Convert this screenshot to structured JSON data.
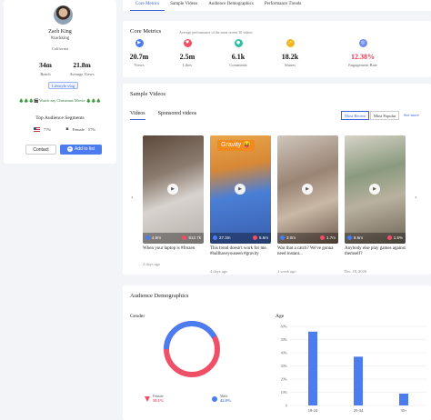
{
  "profile": {
    "name": "Zach King",
    "handle": "#zachking",
    "location": "California",
    "stats": [
      {
        "value": "34m",
        "label": "Reach"
      },
      {
        "value": "21.8m",
        "label": "Average Views"
      }
    ],
    "tag": "Lifestyle vlog",
    "bio": "🎄🎄🎄🎬Watch my Christmas Movie 🎄🎄🎄",
    "segments_title": "Top Audience Segments",
    "segments": [
      {
        "label": "77%"
      },
      {
        "label": "Female",
        "value": "57%"
      }
    ],
    "contact_label": "Contact",
    "add_label": "Add to list",
    "add_icon": "plus-icon"
  },
  "tabs": [
    "Core Metrics",
    "Sample Videos",
    "Audience Demographics",
    "Performance Trends"
  ],
  "core": {
    "title": "Core Metrics",
    "subtitle": "Average performance of the most recent 30 videos",
    "metrics": [
      {
        "value": "20.7m",
        "label": "Views",
        "icon": "play-icon",
        "color": "#4b7cf0"
      },
      {
        "value": "2.5m",
        "label": "Likes",
        "icon": "heart-icon",
        "color": "#ef4f67"
      },
      {
        "value": "6.1k",
        "label": "Comments",
        "icon": "comment-icon",
        "color": "#2fc0a4"
      },
      {
        "value": "18.2k",
        "label": "Shares",
        "icon": "share-icon",
        "color": "#f5b51f"
      },
      {
        "value": "12.38%",
        "label": "Engagement Rate",
        "icon": "engagement-icon",
        "color": "#6f8ef2",
        "value_color": "#e8384f"
      }
    ]
  },
  "videos": {
    "title": "Sample Videos",
    "subtabs": [
      "Videos",
      "Sponsored videos"
    ],
    "sort": [
      "Most Recent",
      "Most Popular",
      "See more"
    ],
    "items": [
      {
        "views": "4.9m",
        "likes": "512.7k",
        "caption": "When your laptop is #frozen",
        "date": "2 days ago"
      },
      {
        "views": "27.3m",
        "likes": "5.6m",
        "caption": "This trend doesn't work for me. #ballhaveyouseen #gravity",
        "date": "4 days ago",
        "overlay": "Gravity 😝"
      },
      {
        "views": "3.0m",
        "likes": "1.7m",
        "caption": "Was that a catch? We've gonna need instant...",
        "date": "1 week ago"
      },
      {
        "views": "8.6m",
        "likes": "1.5%",
        "caption": "Anybody else play games against themself?",
        "date": "Dec 18, 2020"
      }
    ]
  },
  "demographics": {
    "title": "Audience Demographics",
    "gender": {
      "label": "Gender",
      "female": {
        "label": "Female",
        "value": "58.1%"
      },
      "male": {
        "label": "Male",
        "value": "42.0%"
      }
    },
    "age_label": "Age"
  },
  "chart_data": {
    "type": "bar",
    "categories": [
      "18-24",
      "25-34",
      "35+"
    ],
    "values": [
      56,
      37,
      9
    ],
    "ylabel": "Age",
    "yticks": [
      "0",
      "10%",
      "20%",
      "30%",
      "40%",
      "50%",
      "60%"
    ],
    "ylim": [
      0,
      60
    ],
    "colors": {
      "bar": "#4b7cf0",
      "female": "#ef4f67",
      "male": "#4b7cf0"
    }
  }
}
